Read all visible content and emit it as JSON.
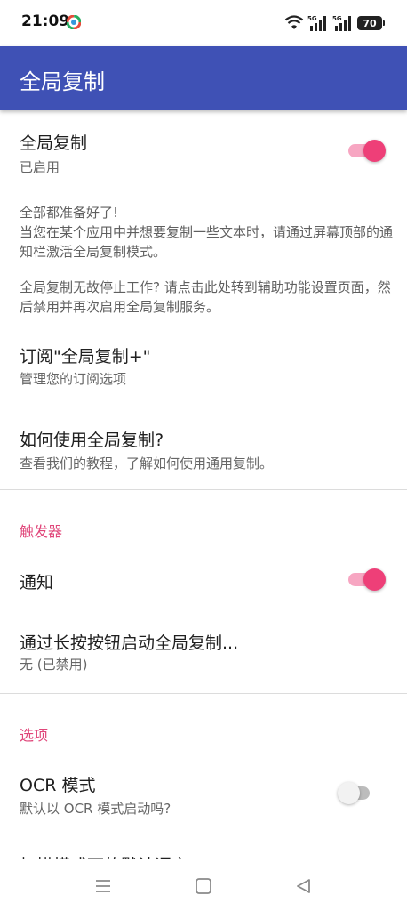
{
  "status_bar": {
    "time": "21:09",
    "network_left": "5G",
    "network_right": "5G",
    "battery": "70"
  },
  "app_bar": {
    "title": "全局复制"
  },
  "preferences": {
    "global_copy": {
      "title": "全局复制",
      "summary": "已启用",
      "enabled": true
    },
    "info": {
      "line1": "全部都准备好了!",
      "line2": "当您在某个应用中并想要复制一些文本时，请通过屏幕顶部的通知栏激活全局复制模式。",
      "line3": "全局复制无故停止工作? 请点击此处转到辅助功能设置页面，然后禁用并再次启用全局复制服务。"
    },
    "subscribe": {
      "title": "订阅\"全局复制+\"",
      "summary": "管理您的订阅选项"
    },
    "how_to": {
      "title": "如何使用全局复制?",
      "summary": "查看我们的教程，了解如何使用通用复制。"
    }
  },
  "triggers": {
    "header": "触发器",
    "notification": {
      "title": "通知",
      "enabled": true
    },
    "long_press": {
      "title": "通过长按按钮启动全局复制...",
      "summary": "无 (已禁用)"
    }
  },
  "options": {
    "header": "选项",
    "ocr_mode": {
      "title": "OCR 模式",
      "summary": "默认以 OCR 模式启动吗?",
      "enabled": false
    },
    "next_item_partial": "扫描模式下的默认语言"
  },
  "colors": {
    "app_bar": "#3f51b5",
    "accent": "#ee3f78",
    "category": "#e0467a"
  },
  "nav_bar": {
    "icons": [
      "menu-icon",
      "home-square-icon",
      "back-triangle-icon"
    ]
  }
}
